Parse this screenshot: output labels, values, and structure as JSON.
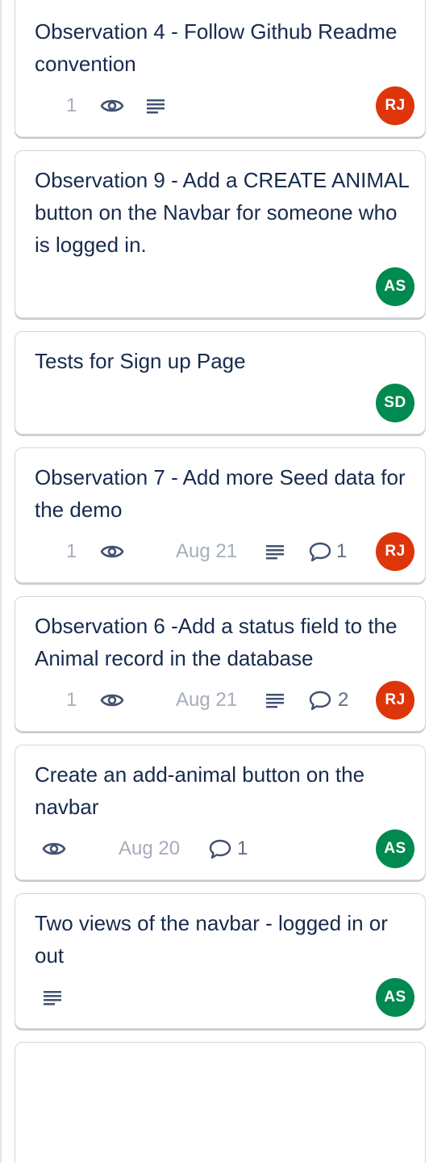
{
  "colors": {
    "avatar_rj": "#de350b",
    "avatar_as": "#008a4f",
    "avatar_sd": "#008a4f"
  },
  "cards": [
    {
      "title": "Observation 4 - Follow Github Readme convention",
      "count": "1",
      "icons": [
        "eye-icon",
        "description-icon"
      ],
      "avatar": "RJ"
    },
    {
      "title": "Observation 9 - Add a CREATE ANIMAL button on the Navbar for someone who is logged in.",
      "avatar": "AS"
    },
    {
      "title": "Tests for Sign up Page",
      "avatar": "SD"
    },
    {
      "title": "Observation 7 - Add more Seed data for the demo",
      "count": "1",
      "date": "Aug 21",
      "comments": "1",
      "icons": [
        "eye-icon",
        "description-icon",
        "comment-icon"
      ],
      "avatar": "RJ"
    },
    {
      "title": "Observation 6 -Add a status field to the Animal record in the database",
      "count": "1",
      "date": "Aug 21",
      "comments": "2",
      "icons": [
        "eye-icon",
        "description-icon",
        "comment-icon"
      ],
      "avatar": "RJ"
    },
    {
      "title": "Create an add-animal button on the navbar",
      "date": "Aug 20",
      "comments": "1",
      "icons": [
        "eye-icon",
        "comment-icon"
      ],
      "avatar": "AS"
    },
    {
      "title": "Two views of the navbar - logged in or out",
      "icons": [
        "description-icon"
      ],
      "avatar": "AS"
    }
  ]
}
